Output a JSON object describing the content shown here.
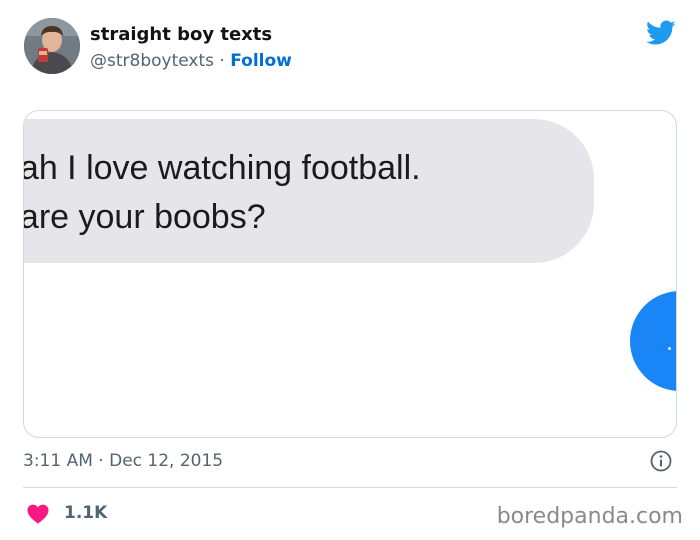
{
  "tweet": {
    "author": {
      "display_name": "straight boy texts",
      "handle": "@str8boytexts",
      "separator": "·",
      "follow_label": "Follow"
    },
    "media": {
      "message_lines": [
        "yeah I love watching football.",
        "ig are your boobs?"
      ]
    },
    "time": "3:11 AM",
    "date": "Dec 12, 2015",
    "meta_separator": "·",
    "likes": "1.1K"
  },
  "icons": {
    "brand": "twitter-bird-icon",
    "info": "info-icon",
    "like": "heart-icon"
  },
  "colors": {
    "twitter_blue": "#1d9bf0",
    "follow_link": "#006fd6",
    "heart": "#f91880",
    "secondary_text": "#536471",
    "imessage_grey": "#e6e5ea",
    "imessage_blue": "#1a85f7"
  },
  "watermark": "boredpanda.com"
}
